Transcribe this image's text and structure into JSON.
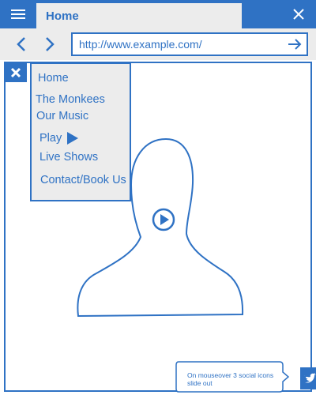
{
  "window": {
    "tab_title": "Home",
    "url": "http://www.example.com/"
  },
  "menu": {
    "items": [
      {
        "label": "Home"
      },
      {
        "label": "The Monkees"
      },
      {
        "label": "Our Music"
      },
      {
        "label": "Play"
      },
      {
        "label": "Live Shows"
      },
      {
        "label": "Contact/Book Us"
      }
    ]
  },
  "note": {
    "text": "On mouseover 3 social icons slide out"
  },
  "icons": {
    "menu": "hamburger-menu-icon",
    "close_window": "close-icon",
    "back": "chevron-left-icon",
    "forward": "chevron-right-icon",
    "go": "arrow-right-icon",
    "close_menu": "close-icon",
    "play": "play-triangle-icon",
    "video_play": "play-circle-icon",
    "social": "twitter-icon"
  },
  "colors": {
    "accent": "#2f72c4",
    "panel": "#ececec"
  }
}
